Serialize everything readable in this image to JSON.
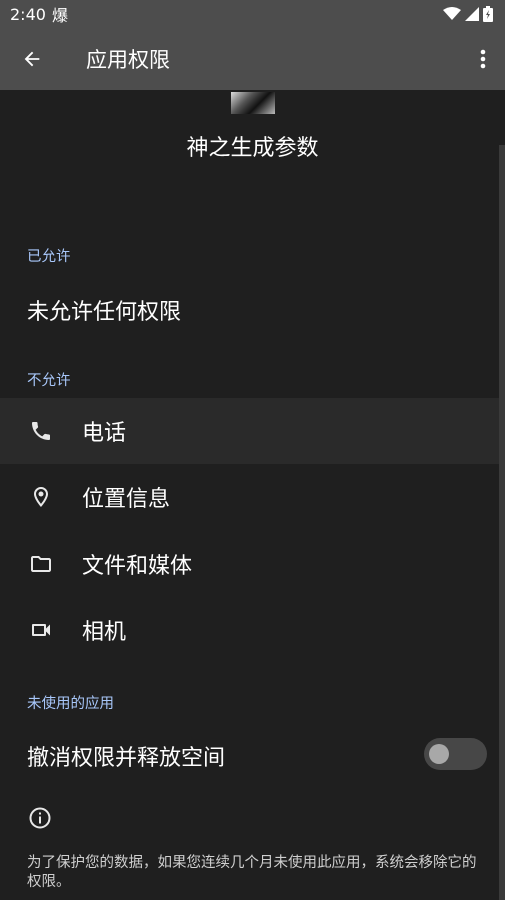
{
  "status_bar": {
    "time": "2:40",
    "extra_glyph": "爆"
  },
  "app_bar": {
    "title": "应用权限"
  },
  "app": {
    "name": "神之生成参数"
  },
  "allowed": {
    "header": "已允许",
    "empty_text": "未允许任何权限"
  },
  "not_allowed": {
    "header": "不允许",
    "items": [
      {
        "label": "电话",
        "icon": "phone-icon"
      },
      {
        "label": "位置信息",
        "icon": "location-icon"
      },
      {
        "label": "文件和媒体",
        "icon": "folder-icon"
      },
      {
        "label": "相机",
        "icon": "camera-icon"
      }
    ]
  },
  "unused_apps": {
    "header": "未使用的应用",
    "toggle_label": "撤消权限并释放空间",
    "toggle_on": false,
    "footer": "为了保护您的数据，如果您连续几个月未使用此应用，系统会移除它的权限。"
  },
  "colors": {
    "accent": "#a8c7fa",
    "appbar": "#4d4d4d",
    "background": "#1f1f1f"
  }
}
